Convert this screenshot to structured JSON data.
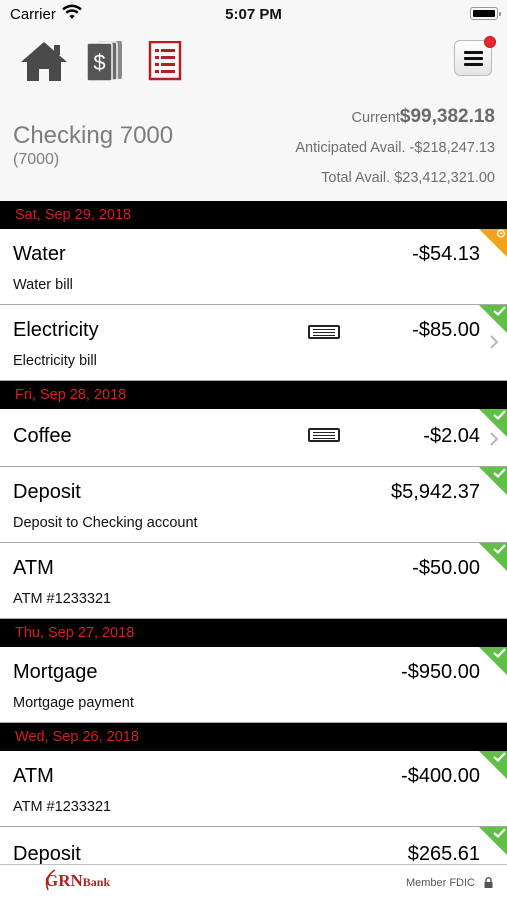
{
  "status_bar": {
    "carrier": "Carrier",
    "time": "5:07 PM"
  },
  "toolbar": {
    "icons": [
      "home-icon",
      "accounts-icon",
      "statements-icon",
      "menu-icon"
    ],
    "notification": true
  },
  "account": {
    "name": "Checking 7000",
    "number": "(7000)",
    "current_label": "Current",
    "current_value": "$99,382.18",
    "anticipated": "Anticipated Avail. -$218,247.13",
    "total": "Total Avail. $23,412,321.00"
  },
  "groups": [
    {
      "date": "Sat, Sep 29, 2018",
      "transactions": [
        {
          "title": "Water",
          "description": "Water bill",
          "amount": "-$54.13",
          "status": "pending",
          "receipt": false,
          "chevron": false
        },
        {
          "title": "Electricity",
          "description": "Electricity bill",
          "amount": "-$85.00",
          "status": "cleared",
          "receipt": true,
          "chevron": true
        }
      ]
    },
    {
      "date": "Fri, Sep 28, 2018",
      "transactions": [
        {
          "title": "Coffee",
          "description": "",
          "amount": "-$2.04",
          "status": "cleared",
          "receipt": true,
          "chevron": true
        },
        {
          "title": "Deposit",
          "description": "Deposit to Checking account",
          "amount": "$5,942.37",
          "status": "cleared",
          "receipt": false,
          "chevron": false
        },
        {
          "title": "ATM",
          "description": "ATM #1233321",
          "amount": "-$50.00",
          "status": "cleared",
          "receipt": false,
          "chevron": false
        }
      ]
    },
    {
      "date": "Thu, Sep 27, 2018",
      "transactions": [
        {
          "title": "Mortgage",
          "description": "Mortgage payment",
          "amount": "-$950.00",
          "status": "cleared",
          "receipt": false,
          "chevron": false
        }
      ]
    },
    {
      "date": "Wed, Sep 26, 2018",
      "transactions": [
        {
          "title": "ATM",
          "description": "ATM #1233321",
          "amount": "-$400.00",
          "status": "cleared",
          "receipt": false,
          "chevron": false
        },
        {
          "title": "Deposit",
          "description": "",
          "amount": "$265.61",
          "status": "cleared",
          "receipt": false,
          "chevron": false
        }
      ]
    }
  ],
  "footer": {
    "logo_grn": "GRN",
    "logo_bank": "Bank",
    "fdic": "Member FDIC"
  },
  "colors": {
    "date_text": "#d51f26",
    "cleared": "#5fbf47",
    "pending": "#f2a31c",
    "brand": "#b21f24"
  }
}
